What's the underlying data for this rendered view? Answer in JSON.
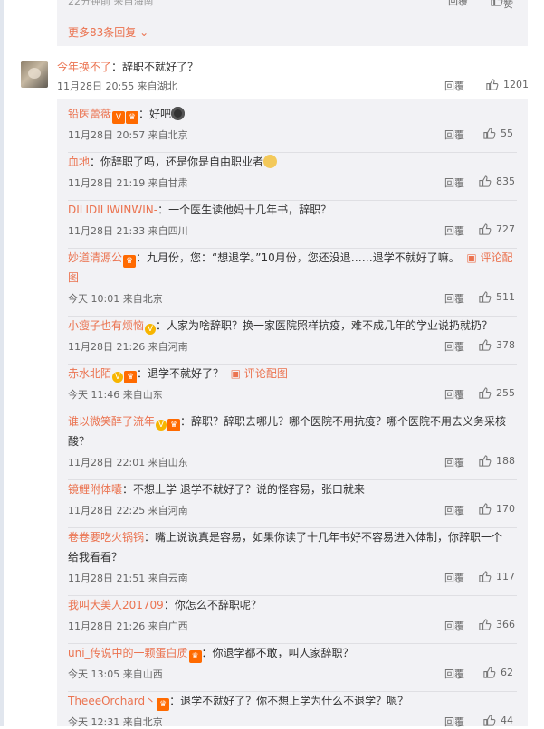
{
  "prev": {
    "meta": "22分钟前 来自海南",
    "reply": "回覆",
    "like": "赞",
    "more": "更多83条回复"
  },
  "main_comment": {
    "name": "今年换不了",
    "text": "：辞职不就好了？",
    "meta": "11月28日 20:55 来自湖北",
    "reply": "回覆",
    "likes": "1201"
  },
  "replies": [
    {
      "name": "铅医蕾薇",
      "text": "：好吧",
      "meta": "11月28日 20:57 来自北京",
      "reply": "回覆",
      "likes": "55"
    },
    {
      "name": "血地",
      "text": "：你辞职了吗，还是你是自由职业者",
      "meta": "11月28日 21:19 来自甘肃",
      "reply": "回覆",
      "likes": "835"
    },
    {
      "name": "DILIDILIWINWIN-",
      "text": "：一个医生读他妈十几年书，辞职？",
      "meta": "11月28日 21:33 来自四川",
      "reply": "回覆",
      "likes": "727"
    },
    {
      "name": "妙道清源公",
      "text": "：九月份，您：“想退学。”10月份，您还没退……退学不就好了嘛。",
      "link": "评论配图",
      "meta": "今天 10:01 来自北京",
      "reply": "回覆",
      "likes": "511"
    },
    {
      "name": "小瘦子也有烦恼",
      "text": "：人家为啥辞职？换一家医院照样抗疫，难不成几年的学业说扔就扔？",
      "meta": "11月28日 21:26 来自河南",
      "reply": "回覆",
      "likes": "378"
    },
    {
      "name": "赤水北陌",
      "text": "：退学不就好了？",
      "link": "评论配图",
      "meta": "今天 11:46 来自山东",
      "reply": "回覆",
      "likes": "255"
    },
    {
      "name": "谁以微笑醉了流年",
      "text": "：辞职？辞职去哪儿？哪个医院不用抗疫？哪个医院不用去义务采核酸？",
      "meta": "11月28日 22:01 来自山东",
      "reply": "回覆",
      "likes": "188"
    },
    {
      "name": "镜鲤附体囔",
      "text": "：不想上学 退学不就好了？说的怪容易，张口就来",
      "meta": "11月28日 22:25 来自河南",
      "reply": "回覆",
      "likes": "170"
    },
    {
      "name": "卷卷要吃火锅锅",
      "text": "：嘴上说说真是容易，如果你读了十几年书好不容易进入体制，你辞职一个给我看看？",
      "meta": "11月28日 21:51 来自云南",
      "reply": "回覆",
      "likes": "117"
    },
    {
      "name": "我叫大美人201709",
      "text": "：你怎么不辞职呢？",
      "meta": "11月28日 21:26 来自广西",
      "reply": "回覆",
      "likes": "366"
    },
    {
      "name": "uni_传说中的一颗蛋白质",
      "text": "：你退学都不敢，叫人家辞职？",
      "meta": "今天 13:05 来自山西",
      "reply": "回覆",
      "likes": "62"
    },
    {
      "name": "TheeeOrchard丶",
      "text": "：退学不就好了？你不想上学为什么不退学？嗯？",
      "meta": "今天 12:31 来自北京",
      "reply": "回覆",
      "likes": "44"
    }
  ]
}
